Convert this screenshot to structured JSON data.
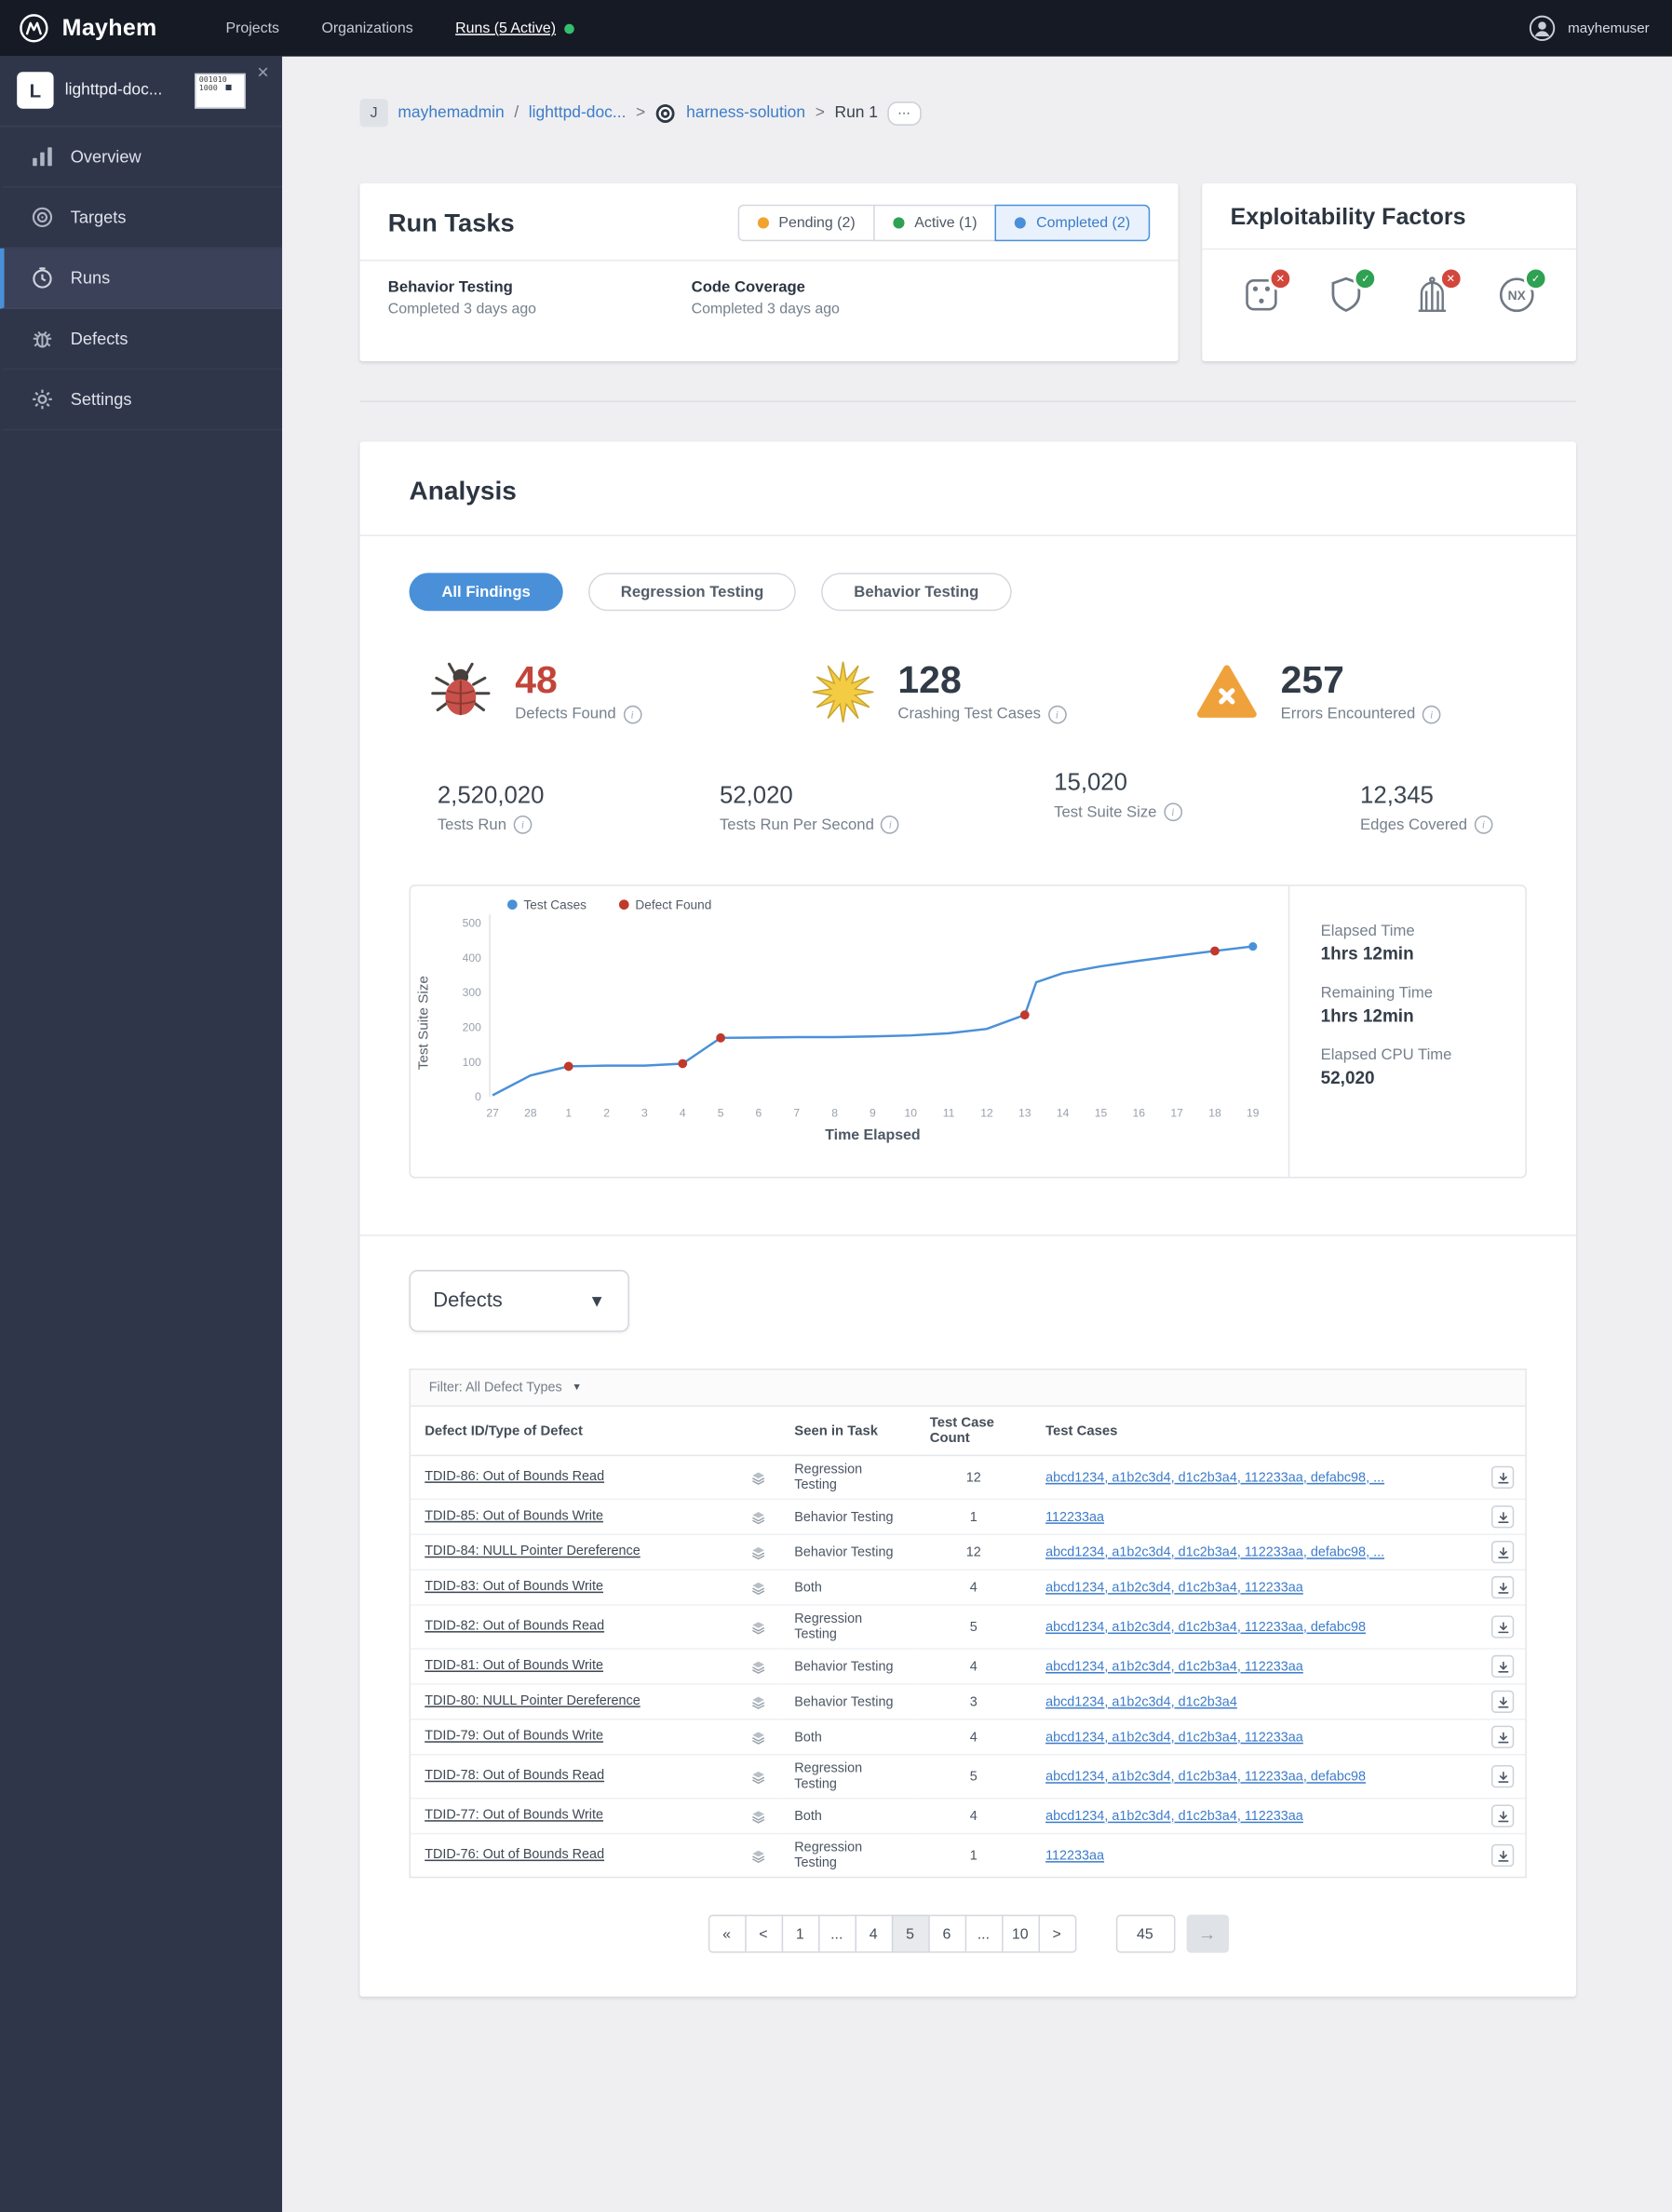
{
  "colors": {
    "accent": "#4A90D9",
    "pending": "#F0A32F",
    "active_green": "#2EA153",
    "fail": "#D2473C",
    "pass": "#2EA153",
    "defect_red": "#C2453A",
    "crash_yellow": "#F3CC44",
    "warn_orange": "#EFA23B"
  },
  "topbar": {
    "brand": "Mayhem",
    "nav": [
      {
        "label": "Projects",
        "active": false
      },
      {
        "label": "Organizations",
        "active": false
      },
      {
        "label": "Runs (5 Active)",
        "active": true,
        "dot": "#33C06E"
      }
    ],
    "user": "mayhemuser"
  },
  "sidebar": {
    "project_initial": "L",
    "project_name": "lighttpd-doc...",
    "thumb_text": "001010 1000",
    "close_glyph": "✕",
    "items": [
      {
        "label": "Overview",
        "icon": "chart",
        "active": false
      },
      {
        "label": "Targets",
        "icon": "target",
        "active": false
      },
      {
        "label": "Runs",
        "icon": "clock",
        "active": true
      },
      {
        "label": "Defects",
        "icon": "bug",
        "active": false
      },
      {
        "label": "Settings",
        "icon": "gear",
        "active": false
      }
    ]
  },
  "breadcrumb": {
    "owner_initial": "J",
    "owner": "mayhemadmin",
    "sep1": "/",
    "project": "lighttpd-doc...",
    "sep2": ">",
    "target": "harness-solution",
    "sep3": ">",
    "run": "Run 1",
    "more": "⋯"
  },
  "run_tasks": {
    "title": "Run Tasks",
    "tabs": [
      {
        "label": "Pending (2)",
        "dot": "#F0A32F",
        "active": false
      },
      {
        "label": "Active (1)",
        "dot": "#2EA153",
        "active": false
      },
      {
        "label": "Completed (2)",
        "dot": "#4A90D9",
        "active": true
      }
    ],
    "tasks": [
      {
        "name": "Behavior Testing",
        "status": "Completed 3 days ago"
      },
      {
        "name": "Code Coverage",
        "status": "Completed 3 days ago"
      }
    ]
  },
  "exploitability": {
    "title": "Exploitability Factors",
    "factors": [
      {
        "icon": "dice",
        "status": "fail",
        "glyph": "✕"
      },
      {
        "icon": "shield",
        "status": "pass",
        "glyph": "✓"
      },
      {
        "icon": "cage",
        "status": "fail",
        "glyph": "✕"
      },
      {
        "icon": "nx",
        "status": "pass",
        "glyph": "✓"
      }
    ]
  },
  "analysis": {
    "title": "Analysis",
    "filters": [
      {
        "label": "All Findings",
        "active": true
      },
      {
        "label": "Regression Testing",
        "active": false
      },
      {
        "label": "Behavior Testing",
        "active": false
      }
    ],
    "stats_primary": [
      {
        "icon": "bug",
        "value": "48",
        "label": "Defects Found",
        "red": true
      },
      {
        "icon": "crash",
        "value": "128",
        "label": "Crashing Test Cases",
        "red": false
      },
      {
        "icon": "warn",
        "value": "257",
        "label": "Errors Encountered",
        "red": false
      }
    ],
    "stats_secondary": [
      {
        "value": "2,520,020",
        "label": "Tests Run"
      },
      {
        "value": "52,020",
        "label": "Tests Run Per Second"
      },
      {
        "value": "15,020",
        "label": "Test Suite Size"
      },
      {
        "value": "12,345",
        "label": "Edges Covered"
      }
    ],
    "side_stats": [
      {
        "label": "Elapsed Time",
        "value": "1hrs 12min"
      },
      {
        "label": "Remaining Time",
        "value": "1hrs 12min"
      },
      {
        "label": "Elapsed CPU Time",
        "value": "52,020"
      }
    ]
  },
  "chart_data": {
    "type": "line",
    "title": "",
    "xlabel": "Time Elapsed",
    "ylabel": "Test Suite Size",
    "ylim": [
      0,
      500
    ],
    "yticks": [
      0,
      100,
      200,
      300,
      400,
      500
    ],
    "xticklabels": [
      "27",
      "28",
      "1",
      "2",
      "3",
      "4",
      "5",
      "6",
      "7",
      "8",
      "9",
      "10",
      "11",
      "12",
      "13",
      "14",
      "15",
      "16",
      "17",
      "18",
      "19"
    ],
    "legend": [
      {
        "label": "Test Cases",
        "color": "#4A90D9"
      },
      {
        "label": "Defect Found",
        "color": "#C0392B"
      }
    ],
    "grid": false,
    "legend_position": "top-left",
    "series": [
      {
        "name": "Test Cases",
        "points": [
          [
            0,
            5
          ],
          [
            1,
            62
          ],
          [
            2,
            88
          ],
          [
            3,
            90
          ],
          [
            4,
            90
          ],
          [
            5,
            96
          ],
          [
            6,
            170
          ],
          [
            7,
            171
          ],
          [
            8,
            172
          ],
          [
            9,
            172
          ],
          [
            10,
            174
          ],
          [
            11,
            177
          ],
          [
            12,
            183
          ],
          [
            13,
            196
          ],
          [
            14,
            236
          ],
          [
            14.3,
            330
          ],
          [
            15,
            356
          ],
          [
            16,
            376
          ],
          [
            17,
            392
          ],
          [
            18,
            406
          ],
          [
            19,
            420
          ],
          [
            20,
            433
          ]
        ]
      }
    ],
    "defect_points": [
      [
        2,
        88
      ],
      [
        5,
        96
      ],
      [
        6,
        170
      ],
      [
        14,
        236
      ],
      [
        19,
        420
      ]
    ]
  },
  "defects_section": {
    "dropdown_label": "Defects",
    "dropdown_chevron": "▼",
    "filter_label": "Filter: All Defect Types",
    "filter_chevron": "▼",
    "table": {
      "headers": [
        "Defect ID/Type of Defect",
        "Seen in Task",
        "Test Case Count",
        "Test Cases"
      ],
      "rows": [
        {
          "id": "TDID-86: Out of Bounds Read",
          "task": "Regression Testing",
          "count": "12",
          "cases": "abcd1234, a1b2c3d4, d1c2b3a4, 112233aa, defabc98, ..."
        },
        {
          "id": "TDID-85: Out of Bounds Write",
          "task": "Behavior Testing",
          "count": "1",
          "cases": "112233aa"
        },
        {
          "id": "TDID-84: NULL Pointer Dereference",
          "task": "Behavior Testing",
          "count": "12",
          "cases": "abcd1234, a1b2c3d4, d1c2b3a4, 112233aa, defabc98, ..."
        },
        {
          "id": "TDID-83: Out of Bounds Write",
          "task": "Both",
          "count": "4",
          "cases": "abcd1234, a1b2c3d4, d1c2b3a4, 112233aa"
        },
        {
          "id": "TDID-82: Out of Bounds Read",
          "task": "Regression Testing",
          "count": "5",
          "cases": "abcd1234, a1b2c3d4, d1c2b3a4, 112233aa, defabc98"
        },
        {
          "id": "TDID-81: Out of Bounds Write",
          "task": "Behavior Testing",
          "count": "4",
          "cases": "abcd1234, a1b2c3d4, d1c2b3a4, 112233aa"
        },
        {
          "id": "TDID-80: NULL Pointer Dereference",
          "task": "Behavior Testing",
          "count": "3",
          "cases": "abcd1234, a1b2c3d4, d1c2b3a4"
        },
        {
          "id": "TDID-79: Out of Bounds Write",
          "task": "Both",
          "count": "4",
          "cases": "abcd1234, a1b2c3d4, d1c2b3a4, 112233aa"
        },
        {
          "id": "TDID-78: Out of Bounds Read",
          "task": "Regression Testing",
          "count": "5",
          "cases": "abcd1234, a1b2c3d4, d1c2b3a4, 112233aa, defabc98"
        },
        {
          "id": "TDID-77: Out of Bounds Write",
          "task": "Both",
          "count": "4",
          "cases": "abcd1234, a1b2c3d4, d1c2b3a4, 112233aa"
        },
        {
          "id": "TDID-76: Out of Bounds Read",
          "task": "Regression Testing",
          "count": "1",
          "cases": "112233aa"
        }
      ]
    },
    "pagination": {
      "items": [
        {
          "label": "«",
          "active": false
        },
        {
          "label": "<",
          "active": false
        },
        {
          "label": "1",
          "active": false
        },
        {
          "label": "...",
          "active": false
        },
        {
          "label": "4",
          "active": false
        },
        {
          "label": "5",
          "active": true
        },
        {
          "label": "6",
          "active": false
        },
        {
          "label": "...",
          "active": false
        },
        {
          "label": "10",
          "active": false
        },
        {
          "label": ">",
          "active": false
        }
      ],
      "jump_value": "45",
      "go_glyph": "→"
    }
  }
}
